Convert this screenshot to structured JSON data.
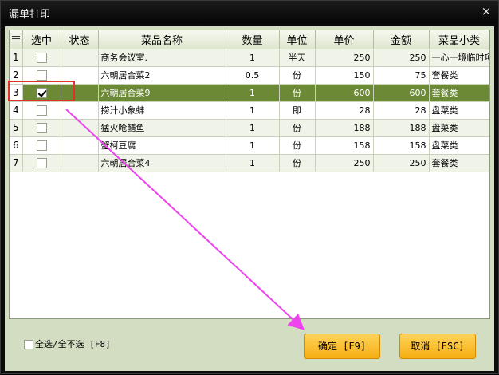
{
  "window": {
    "title": "漏单打印",
    "close_label": "×"
  },
  "table": {
    "headers": [
      "",
      "选中",
      "状态",
      "菜品名称",
      "数量",
      "单位",
      "单价",
      "金额",
      "菜品小类"
    ],
    "rows": [
      {
        "num": "1",
        "checked": false,
        "status": "",
        "name": "商务会议室.",
        "qty": "1",
        "unit": "半天",
        "price": "250",
        "amount": "250",
        "category": "一心一境临时项"
      },
      {
        "num": "2",
        "checked": false,
        "status": "",
        "name": "六朝居合菜2",
        "qty": "0.5",
        "unit": "份",
        "price": "150",
        "amount": "75",
        "category": "套餐类"
      },
      {
        "num": "3",
        "checked": true,
        "status": "",
        "name": "六朝居合菜9",
        "qty": "1",
        "unit": "份",
        "price": "600",
        "amount": "600",
        "category": "套餐类"
      },
      {
        "num": "4",
        "checked": false,
        "status": "",
        "name": "捞汁小象蚌",
        "qty": "1",
        "unit": "即",
        "price": "28",
        "amount": "28",
        "category": "盘菜类"
      },
      {
        "num": "5",
        "checked": false,
        "status": "",
        "name": "猛火呛鳝鱼",
        "qty": "1",
        "unit": "份",
        "price": "188",
        "amount": "188",
        "category": "盘菜类"
      },
      {
        "num": "6",
        "checked": false,
        "status": "",
        "name": "蟹柯豆腐",
        "qty": "1",
        "unit": "份",
        "price": "158",
        "amount": "158",
        "category": "盘菜类"
      },
      {
        "num": "7",
        "checked": false,
        "status": "",
        "name": "六朝居合菜4",
        "qty": "1",
        "unit": "份",
        "price": "250",
        "amount": "250",
        "category": "套餐类"
      }
    ]
  },
  "footer": {
    "select_all_label": "全选/全不选 [F8]",
    "ok_label": "确定 [F9]",
    "cancel_label": "取消 [ESC]"
  },
  "colors": {
    "selected_row": "#6c8a35",
    "annotation_box": "#e0322a",
    "annotation_arrow": "#ee44ee",
    "button": "#f6ae12"
  }
}
